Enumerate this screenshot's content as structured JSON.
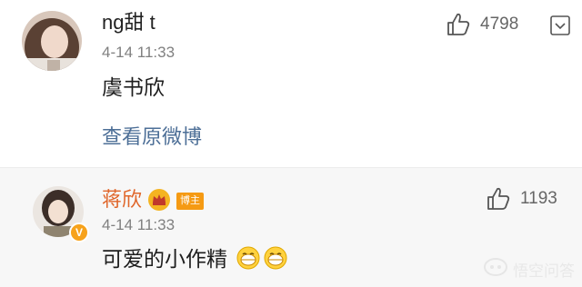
{
  "comment1": {
    "username": "ng甜 t",
    "time": "4-14 11:33",
    "text": "虞书欣",
    "view_original": "查看原微博",
    "likes": "4798"
  },
  "comment2": {
    "username": "蒋欣",
    "badge": "博主",
    "time": "4-14 11:33",
    "text": "可爱的小作精",
    "likes": "1193"
  },
  "watermark": "悟空问答",
  "colors": {
    "link": "#4d6f97",
    "name2": "#e0662a",
    "badge": "#f59a13"
  }
}
